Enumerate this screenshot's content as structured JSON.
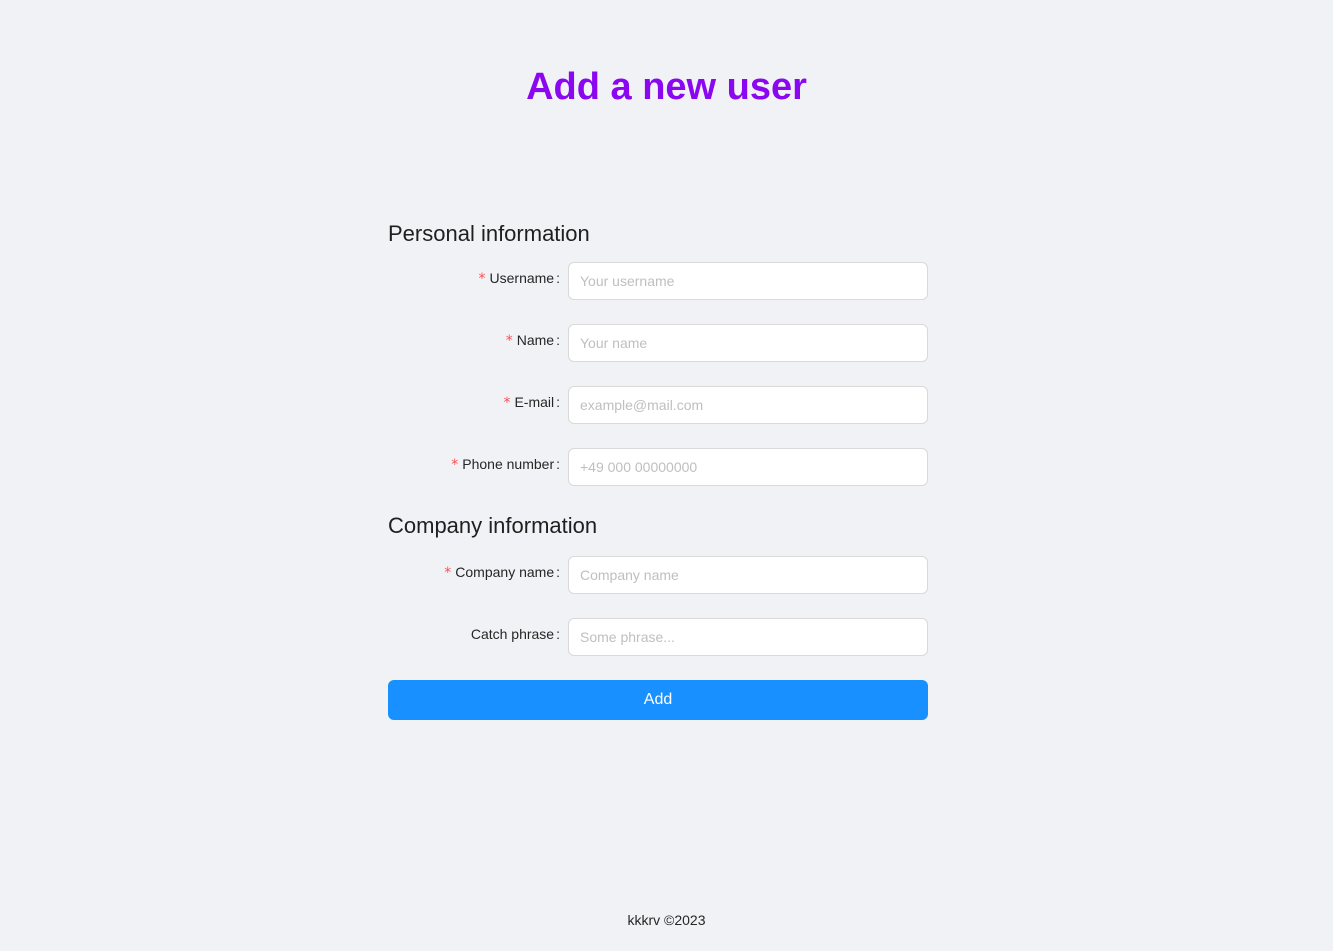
{
  "page": {
    "title": "Add a new user"
  },
  "personal": {
    "title": "Personal information",
    "fields": [
      {
        "label": "Username",
        "placeholder": "Your username",
        "required": "*"
      },
      {
        "label": "Name",
        "placeholder": "Your name",
        "required": "*"
      },
      {
        "label": "E-mail",
        "placeholder": "example@mail.com",
        "required": "*"
      },
      {
        "label": "Phone number",
        "placeholder": "+49 000 00000000",
        "required": "*"
      }
    ]
  },
  "company": {
    "title": "Company information",
    "fields": [
      {
        "label": "Company name",
        "placeholder": "Company name",
        "required": "*"
      },
      {
        "label": "Catch phrase",
        "placeholder": "Some phrase..."
      }
    ]
  },
  "actions": {
    "add_label": "Add"
  },
  "footer": {
    "text": "kkkrv ©2023"
  },
  "colors": {
    "title": "#8a07f0",
    "primary": "#1890ff",
    "required": "#ff4d4f",
    "background": "#f0f2f5"
  }
}
